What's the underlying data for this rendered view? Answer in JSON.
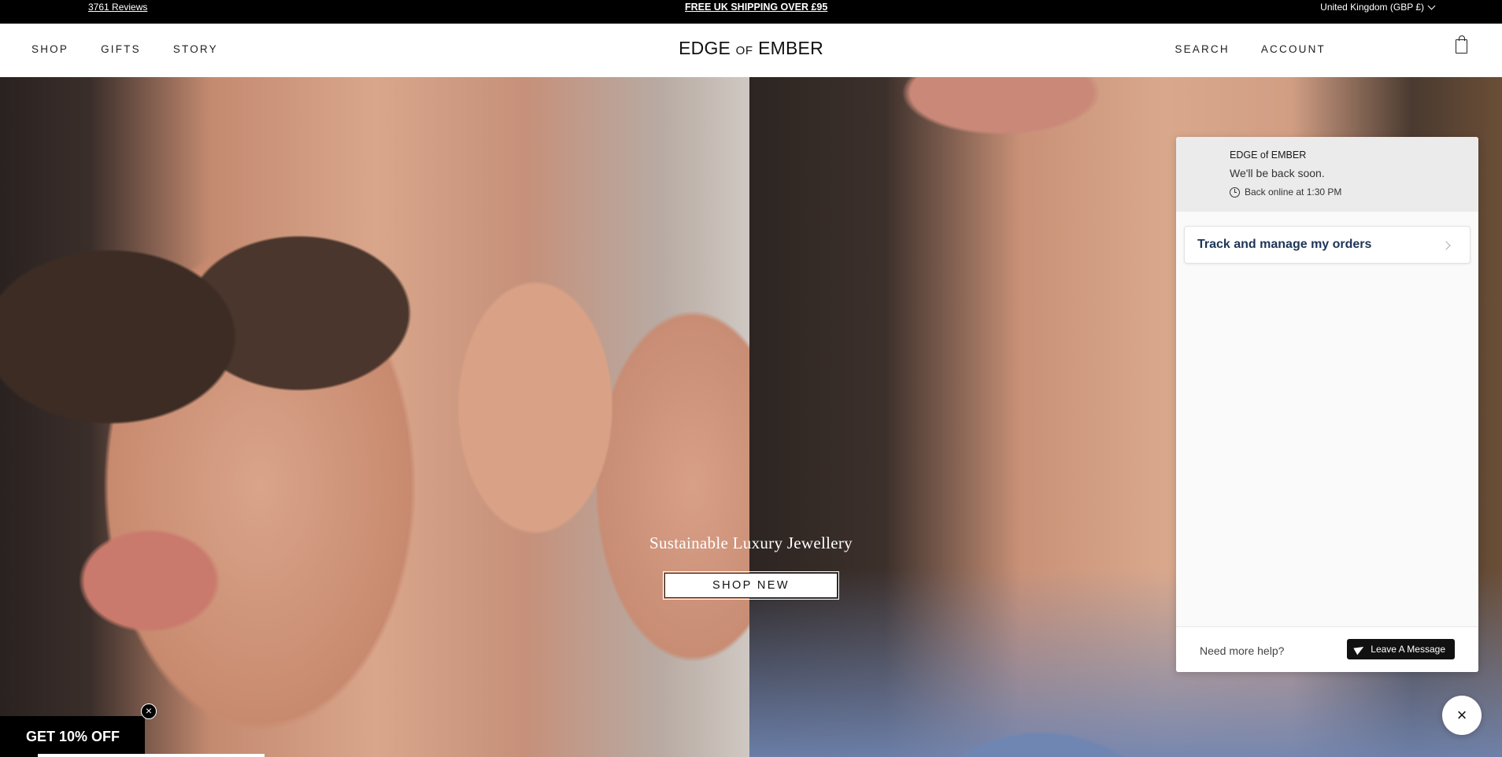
{
  "announcement": {
    "reviews": "3761 Reviews",
    "shipping": "FREE UK SHIPPING OVER £95",
    "country": "United Kingdom (GBP £)"
  },
  "header": {
    "nav_left": [
      "SHOP",
      "GIFTS",
      "STORY"
    ],
    "logo_main_1": "EDGE",
    "logo_of": "OF",
    "logo_main_2": "EMBER",
    "search": "SEARCH",
    "account": "ACCOUNT"
  },
  "hero": {
    "title": "Sustainable Luxury Jewellery",
    "cta": "SHOP NEW"
  },
  "promo": {
    "label": "GET 10% OFF",
    "close": "×"
  },
  "chat": {
    "brand": "EDGE of EMBER",
    "status": "We'll be back soon.",
    "online": "Back online at 1:30 PM",
    "track": "Track and manage my orders",
    "need_help": "Need more help?",
    "leave_message": "Leave A Message",
    "close": "×"
  },
  "icons": {
    "bag": "shopping-bag-icon",
    "clock": "clock-icon",
    "plane": "paper-plane-icon"
  }
}
